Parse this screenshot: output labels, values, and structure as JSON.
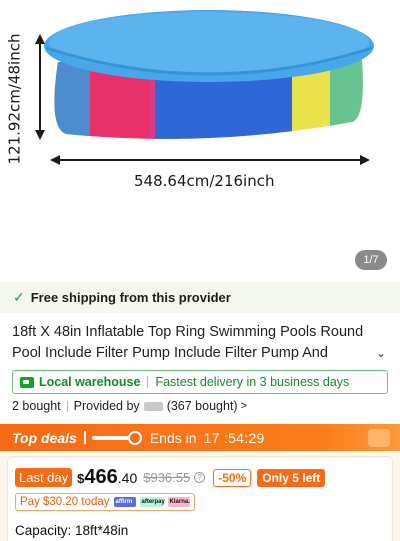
{
  "image": {
    "height_label": "121.92cm/48inch",
    "width_label": "548.64cm/216inch",
    "pager": "1/7",
    "colors": {
      "cover": "#47a7ea",
      "pink": "#e8316b",
      "blue": "#2f67d6",
      "yellow": "#e9e24c"
    }
  },
  "shipping": {
    "text": "Free shipping from this provider"
  },
  "product": {
    "title": "18ft X 48in Inflatable Top Ring Swimming Pools Round Pool Include Filter Pump Include Filter Pump And"
  },
  "warehouse": {
    "label": "Local warehouse",
    "delivery": "Fastest delivery in 3 business days"
  },
  "stats": {
    "bought": "2 bought",
    "provided_by": "Provided by",
    "provider_bought": "(367 bought)"
  },
  "deals": {
    "label": "Top deals",
    "ends": "Ends in",
    "timer": "17 :54:29"
  },
  "price": {
    "last_day": "Last day",
    "currency": "$",
    "whole": "466",
    "cents": ".40",
    "original": "$936.55",
    "discount": "-50%",
    "stock": "Only 5 left",
    "pay_today": "Pay $30.20 today",
    "payment_methods": [
      "affirm",
      "afterpay",
      "Klarna."
    ]
  },
  "options": {
    "capacity": "Capacity: 18ft*48in"
  },
  "accent_color": "#f86a14",
  "success_color": "#1b9e2e"
}
